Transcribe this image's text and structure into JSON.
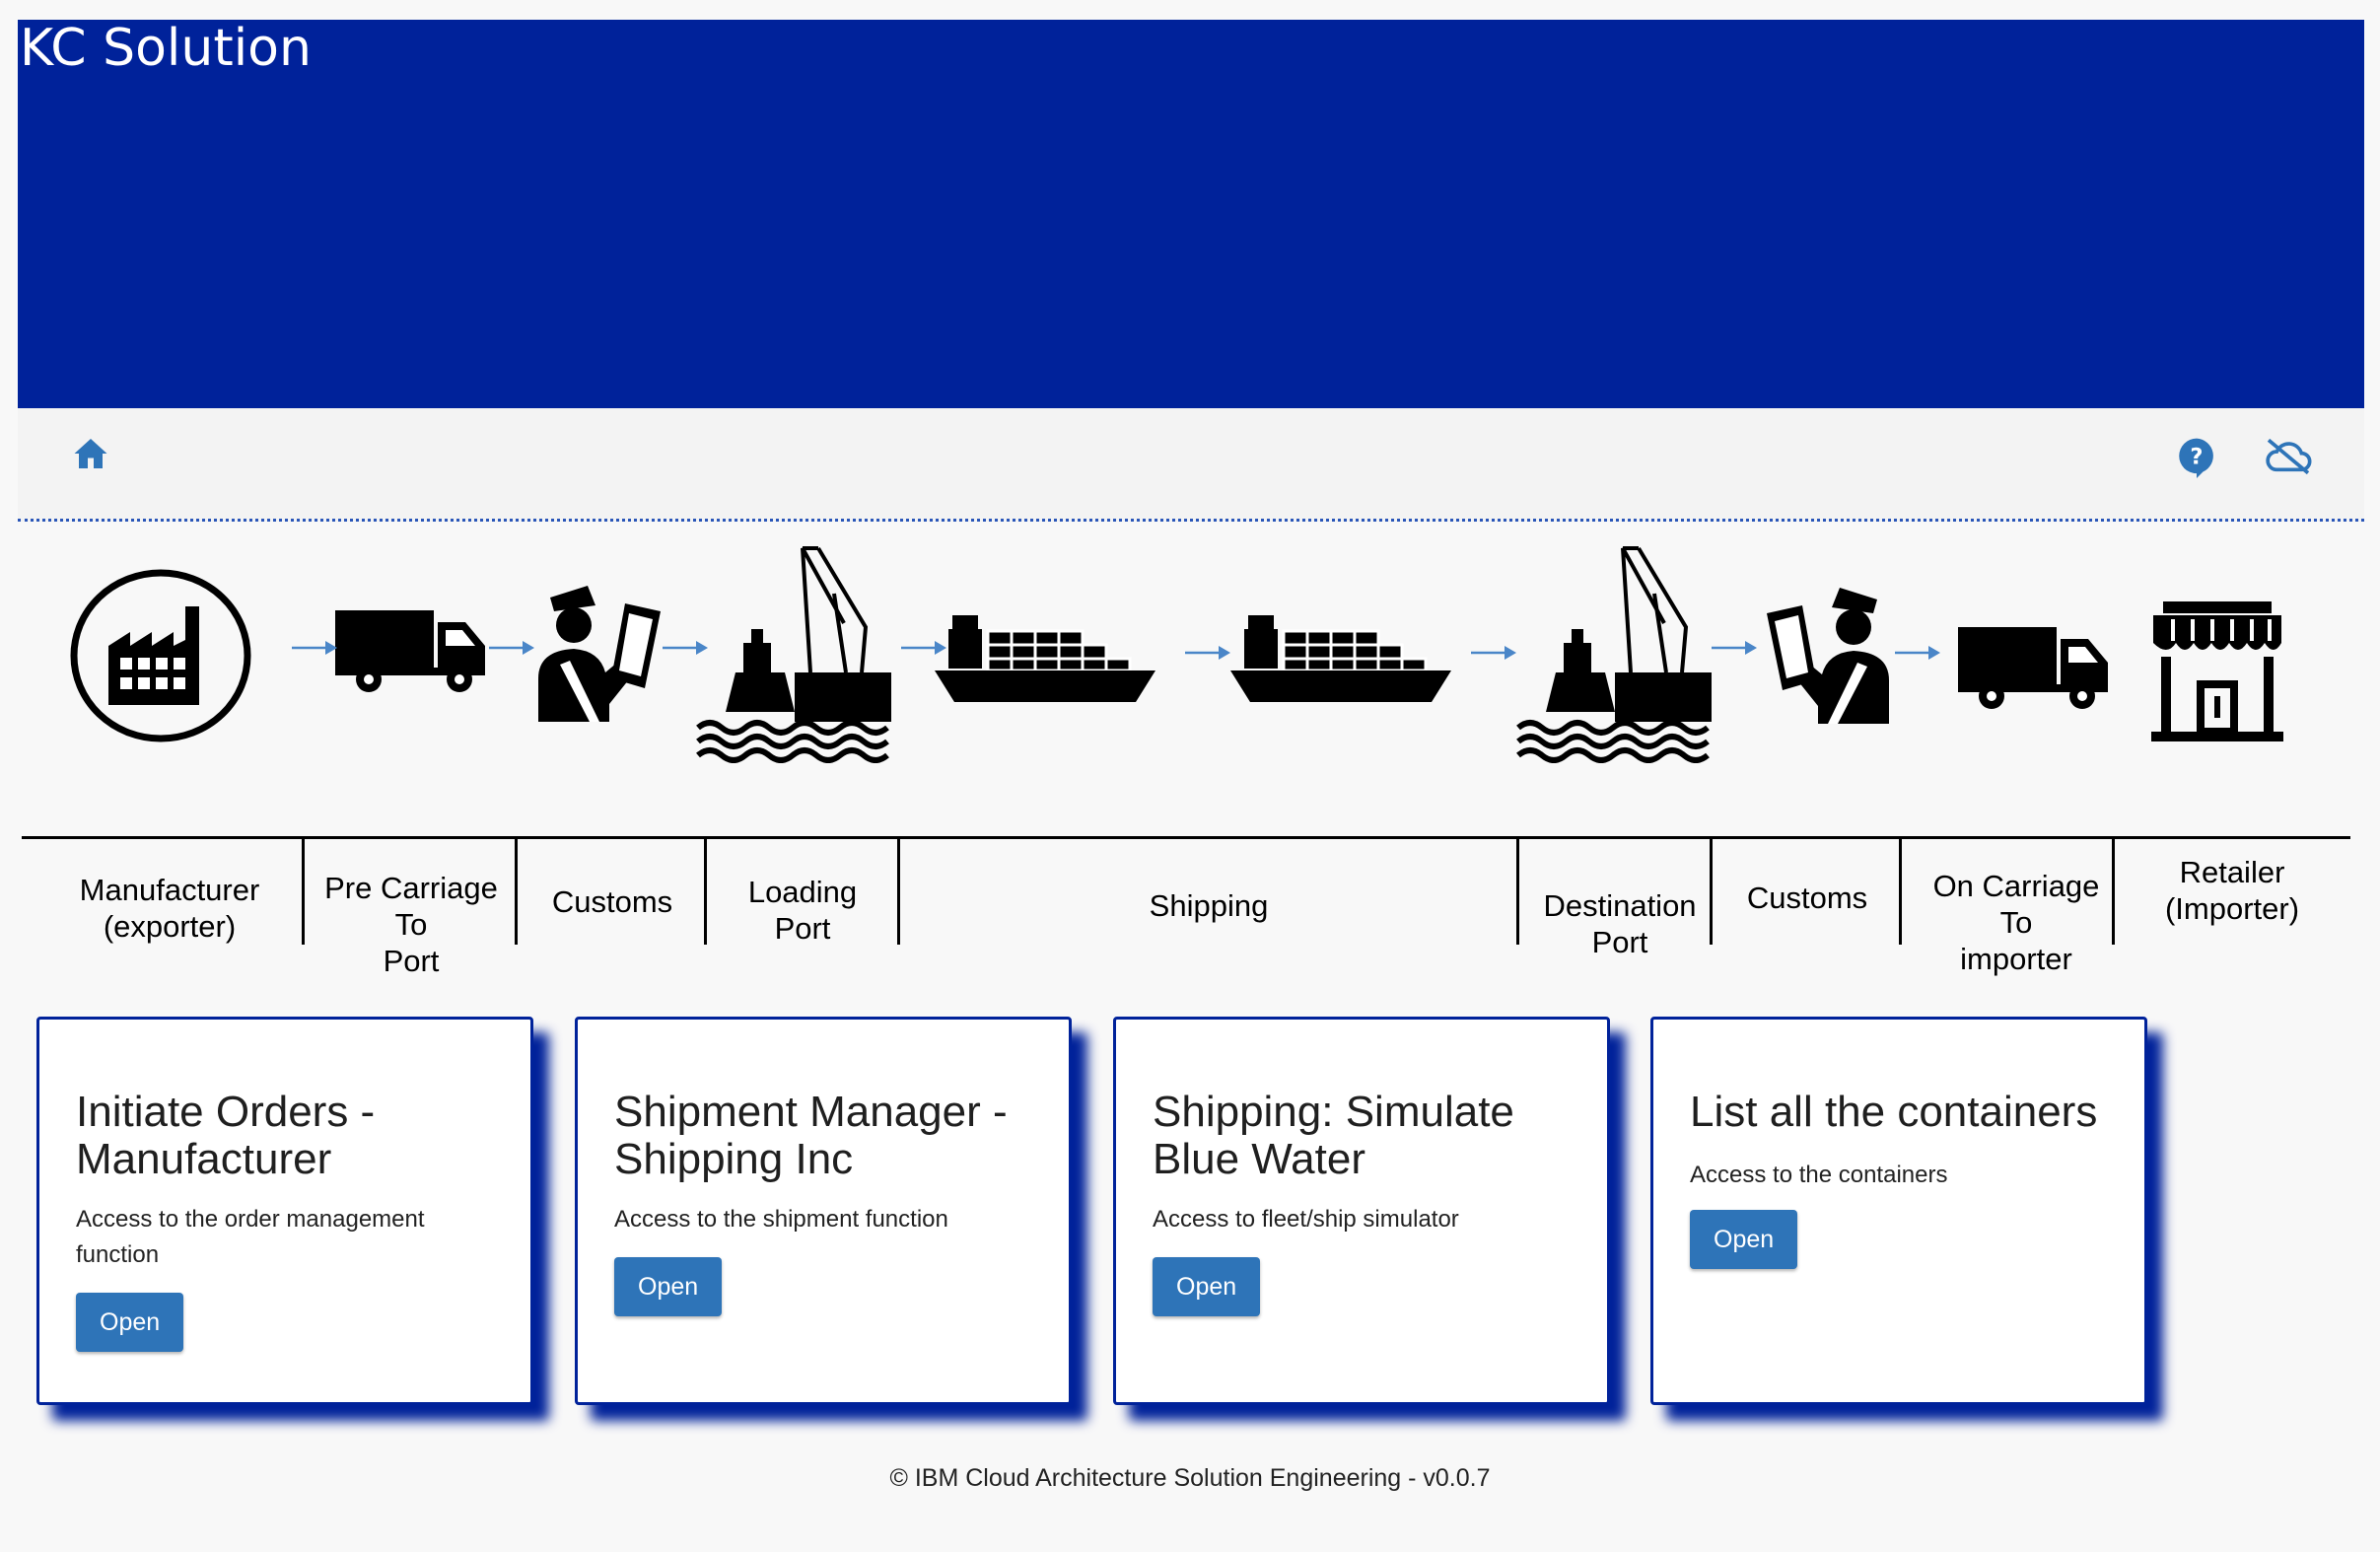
{
  "app": {
    "title": "KC Solution"
  },
  "toolbar": {
    "home_icon": "home-icon",
    "help_icon": "help-icon",
    "cloud_icon": "cloud-offline-icon",
    "accent": "#2e74b8"
  },
  "banner": {
    "background": "#00229a"
  },
  "pipeline": {
    "stages": [
      {
        "label": "Manufacturer\n(exporter)",
        "icon": "factory-icon"
      },
      {
        "label": "Pre Carriage\nTo\nPort",
        "icon": "truck-icon"
      },
      {
        "label": "Customs",
        "icon": "customs-officer-icon"
      },
      {
        "label": "Loading\nPort",
        "icon": "port-crane-icon"
      },
      {
        "label": "Shipping",
        "icon": "container-ship-icon"
      },
      {
        "label": "Destination\nPort",
        "icon": "port-crane-icon"
      },
      {
        "label": "Customs",
        "icon": "customs-officer-icon"
      },
      {
        "label": "On Carriage\nTo\nimporter",
        "icon": "truck-icon"
      },
      {
        "label": "Retailer\n(Importer)",
        "icon": "store-icon"
      }
    ]
  },
  "cards": [
    {
      "title": "Initiate Orders - Manufacturer",
      "description": "Access to the order management function",
      "button": "Open"
    },
    {
      "title": "Shipment Manager - Shipping Inc",
      "description": "Access to the shipment function",
      "button": "Open"
    },
    {
      "title": "Shipping: Simulate Blue Water",
      "description": "Access to fleet/ship simulator",
      "button": "Open"
    },
    {
      "title": "List all the containers",
      "description": "Access to the containers",
      "button": "Open"
    }
  ],
  "footer": {
    "text": "© IBM Cloud Architecture Solution Engineering - v0.0.7"
  }
}
